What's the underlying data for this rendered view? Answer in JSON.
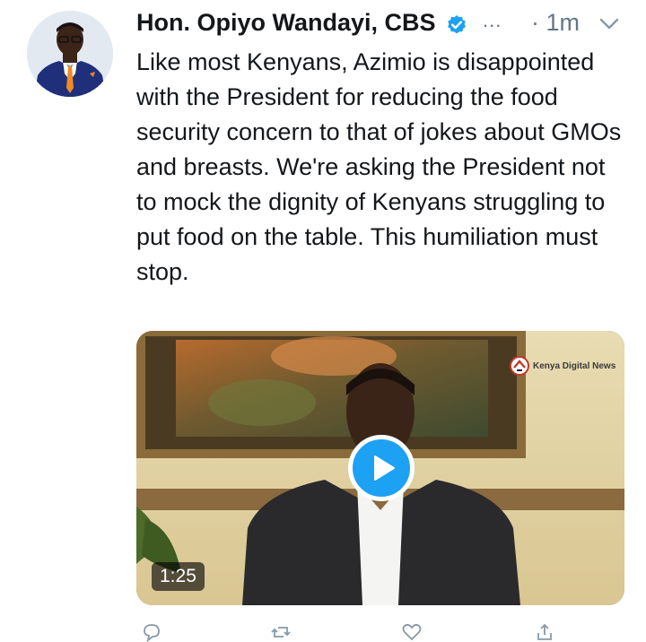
{
  "tweet": {
    "author_name": "Hon. Opiyo Wandayi, CBS",
    "more_label": "...",
    "time": "· 1m",
    "text": "Like most Kenyans, Azimio is disappointed with the President for reducing the food security concern to that of jokes about GMOs and breasts. We're asking the President not to mock the dignity of Kenyans struggling to put food on the table. This humiliation must stop.",
    "verified": true
  },
  "video": {
    "duration": "1:25",
    "watermark": "Kenya Digital News"
  },
  "actions": {
    "icons": [
      "reply-icon",
      "retweet-icon",
      "like-icon",
      "share-icon"
    ]
  },
  "colors": {
    "accent": "#1da1f2",
    "text": "#14171a",
    "muted": "#657786"
  }
}
